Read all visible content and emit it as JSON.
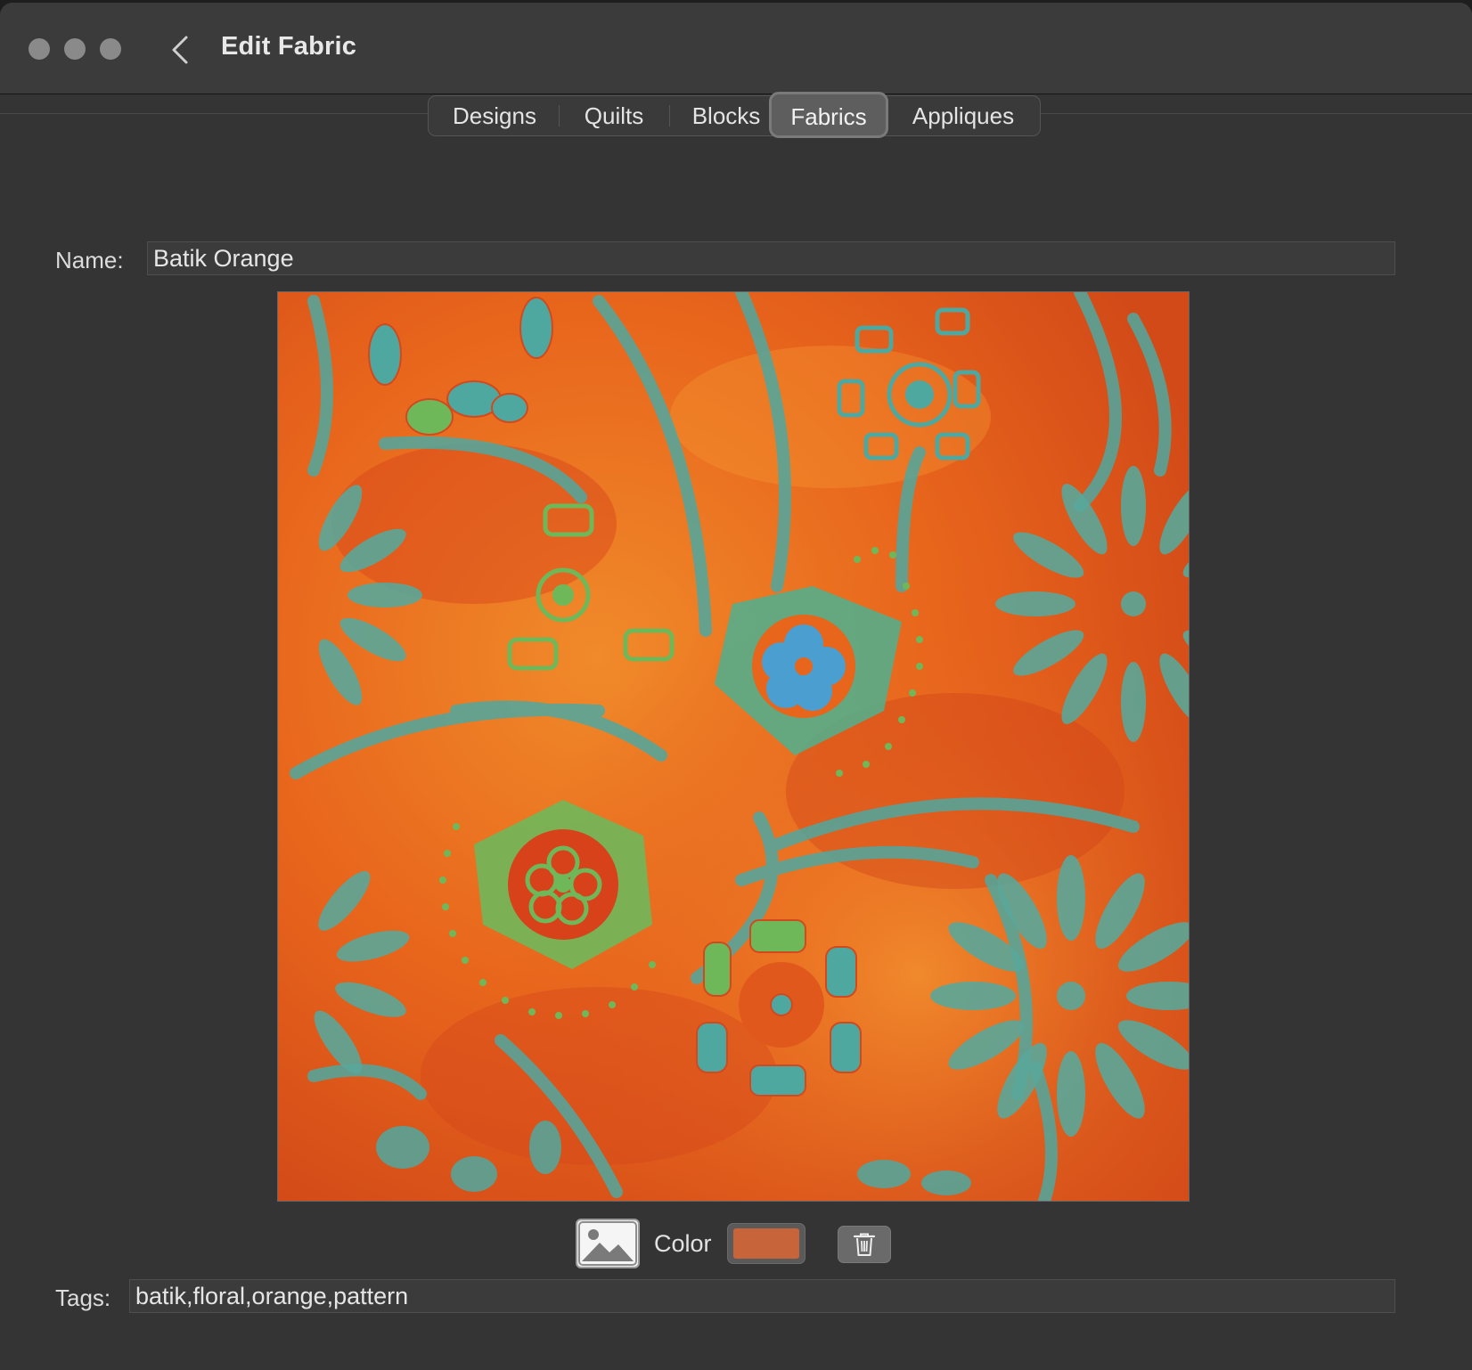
{
  "window": {
    "title": "Edit Fabric",
    "back_icon": "chevron-left-icon"
  },
  "tabs": [
    {
      "label": "Designs",
      "selected": false
    },
    {
      "label": "Quilts",
      "selected": false
    },
    {
      "label": "Blocks",
      "selected": false
    },
    {
      "label": "Fabrics",
      "selected": true
    },
    {
      "label": "Appliques",
      "selected": false
    }
  ],
  "form": {
    "name_label": "Name:",
    "name_value": "Batik Orange",
    "color_label": "Color",
    "color_value": "#c8643a",
    "tags_label": "Tags:",
    "tags_value": "batik,floral,orange,pattern"
  },
  "fabric": {
    "image_icon": "photo-icon",
    "delete_icon": "trash-icon",
    "base_color": "#e96a1c",
    "accent_colors": [
      "#4fa8a0",
      "#6fb85a",
      "#d2491e"
    ]
  }
}
